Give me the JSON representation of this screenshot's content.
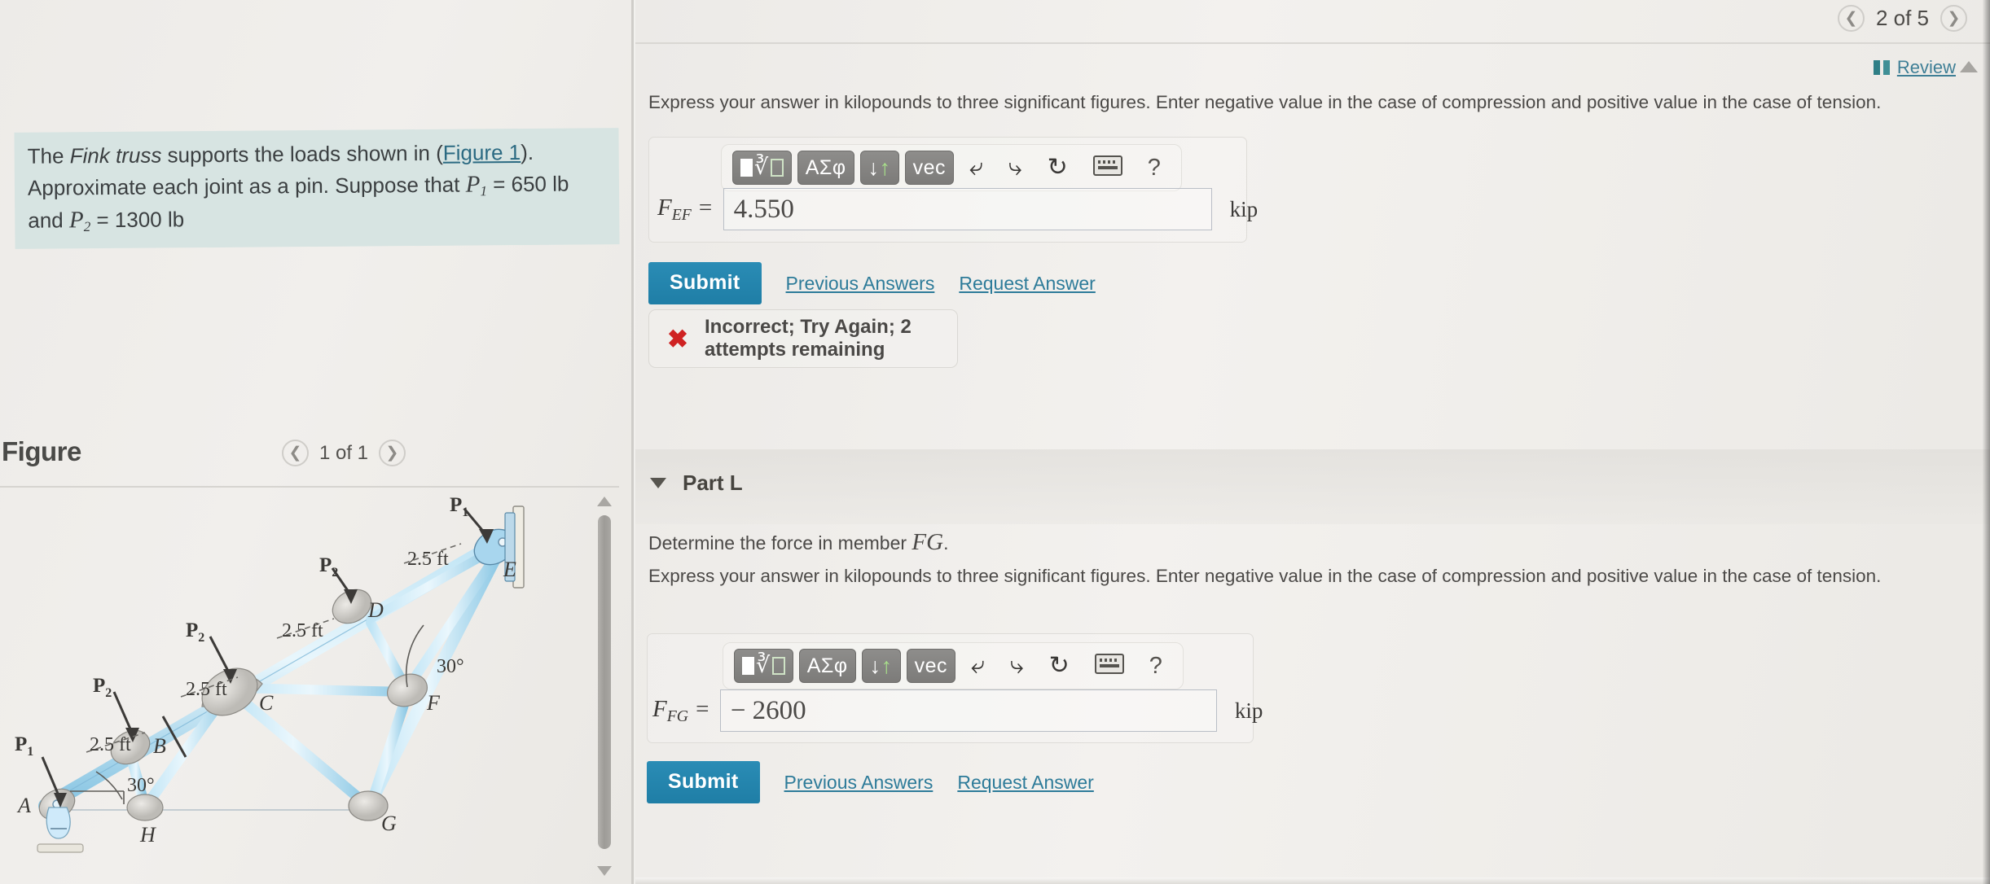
{
  "left": {
    "problem_prefix": "The ",
    "problem_italic_1": "Fink truss",
    "problem_mid_1": " supports the loads shown in (",
    "figure_link": "Figure 1",
    "problem_mid_2": "). Approximate each joint as a pin. Suppose that ",
    "p1_symbol": "P",
    "p1_sub": "1",
    "p1_value": " = 650 lb and ",
    "p2_symbol": "P",
    "p2_sub": "2",
    "p2_value": " = 1300 lb",
    "figure_title": "Figure",
    "figure_counter": "1 of 1",
    "figure_prev_icon": "chevron-left-icon",
    "figure_next_icon": "chevron-right-icon"
  },
  "figure": {
    "joints": [
      "A",
      "B",
      "C",
      "D",
      "E",
      "F",
      "G",
      "H"
    ],
    "load_labels": [
      "P1",
      "P2",
      "P2",
      "P2",
      "P1"
    ],
    "dimension_labels": [
      "2.5 ft",
      "2.5 ft",
      "2.5 ft",
      "2.5 ft"
    ],
    "angle_labels": [
      "30°",
      "30°"
    ],
    "p_symbol": "P",
    "p1_sub": "1",
    "p2_sub": "2",
    "dim": "2.5 ft",
    "angle": "30°"
  },
  "topbar": {
    "page_counter": "2 of 5",
    "prev_icon": "chevron-left-icon",
    "next_icon": "chevron-right-icon",
    "review_label": "Review",
    "review_icon": "book-icon"
  },
  "parts": [
    {
      "instruction": "Express your answer in kilopounds to three significant figures. Enter negative value in the case of compression and positive value in the case of tension.",
      "field_symbol": "F",
      "field_subscript": "EF",
      "field_equals": "=",
      "value": "4.550",
      "unit": "kip",
      "submit_label": "Submit",
      "previous_answers_label": "Previous Answers",
      "request_answer_label": "Request Answer",
      "feedback_icon": "x-mark-icon",
      "feedback_text": "Incorrect; Try Again; 2 attempts remaining"
    },
    {
      "header": "Part L",
      "caret_icon": "caret-down-icon",
      "question": "Determine the force in member ",
      "question_member": "FG",
      "question_period": ".",
      "instruction": "Express your answer in kilopounds to three significant figures. Enter negative value in the case of compression and positive value in the case of tension.",
      "field_symbol": "F",
      "field_subscript": "FG",
      "field_equals": "=",
      "value": "− 2600",
      "unit": "kip",
      "submit_label": "Submit",
      "previous_answers_label": "Previous Answers",
      "request_answer_label": "Request Answer"
    }
  ],
  "toolbar": {
    "template_button": "template-root-button",
    "greek_button": "ΑΣφ",
    "arrows_button": "updown-arrows-button",
    "vec_button": "vec",
    "undo_icon": "undo-icon",
    "redo_icon": "redo-icon",
    "reset_icon": "reset-icon",
    "keyboard_icon": "keyboard-icon",
    "help_icon": "?"
  },
  "colors": {
    "accent": "#2a8cb5",
    "link": "#2d7b99",
    "error": "#cf2222",
    "highlight": "#d7e4e2",
    "truss_blue": "#9fd4ec"
  }
}
